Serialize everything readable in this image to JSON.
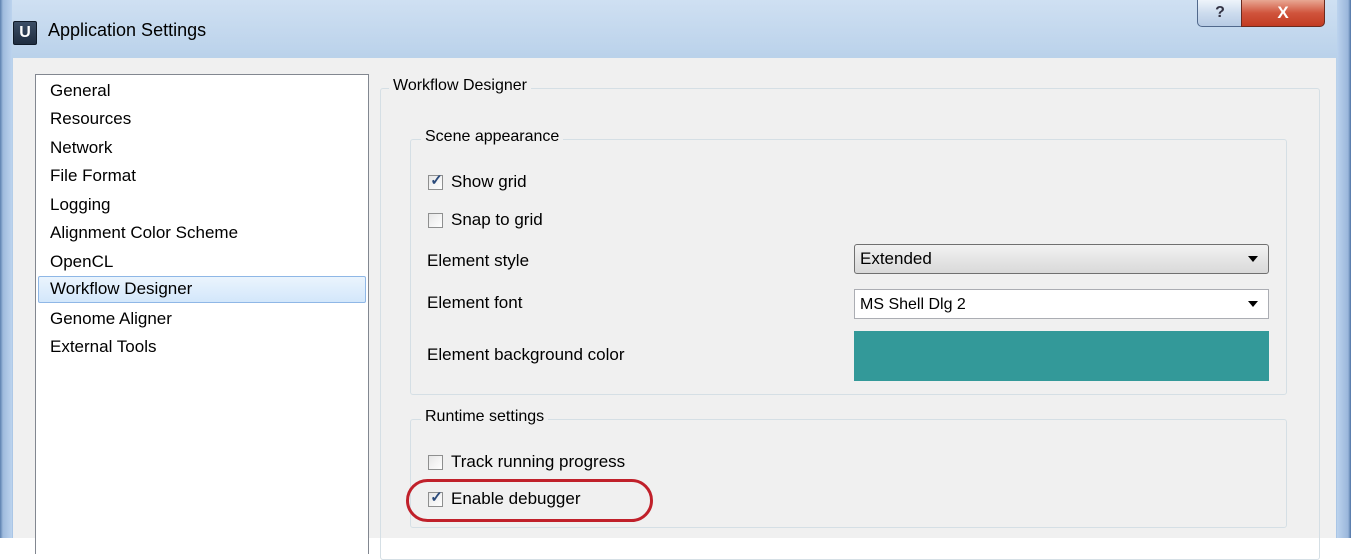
{
  "window": {
    "icon_letter": "U",
    "title": "Application Settings",
    "help_button": "?",
    "close_button": "X"
  },
  "nav": {
    "items": [
      {
        "label": "General"
      },
      {
        "label": "Resources"
      },
      {
        "label": "Network"
      },
      {
        "label": "File Format"
      },
      {
        "label": "Logging"
      },
      {
        "label": "Alignment Color Scheme"
      },
      {
        "label": "OpenCL"
      },
      {
        "label": "Workflow Designer",
        "selected": true
      },
      {
        "label": "Genome Aligner"
      },
      {
        "label": "External Tools"
      }
    ]
  },
  "panel": {
    "title": "Workflow Designer",
    "scene": {
      "title": "Scene appearance",
      "show_grid": {
        "label": "Show grid",
        "checked": true
      },
      "snap_to_grid": {
        "label": "Snap to grid",
        "checked": false
      },
      "element_style": {
        "label": "Element style",
        "value": "Extended"
      },
      "element_font": {
        "label": "Element font",
        "value": "MS Shell Dlg 2"
      },
      "element_bg": {
        "label": "Element background color",
        "color": "#339999"
      }
    },
    "runtime": {
      "title": "Runtime settings",
      "track_progress": {
        "label": "Track running progress",
        "checked": false
      },
      "enable_debugger": {
        "label": "Enable debugger",
        "checked": true
      }
    }
  },
  "colors": {
    "highlight": "#c0202a",
    "selection": "#d3e7fb"
  }
}
